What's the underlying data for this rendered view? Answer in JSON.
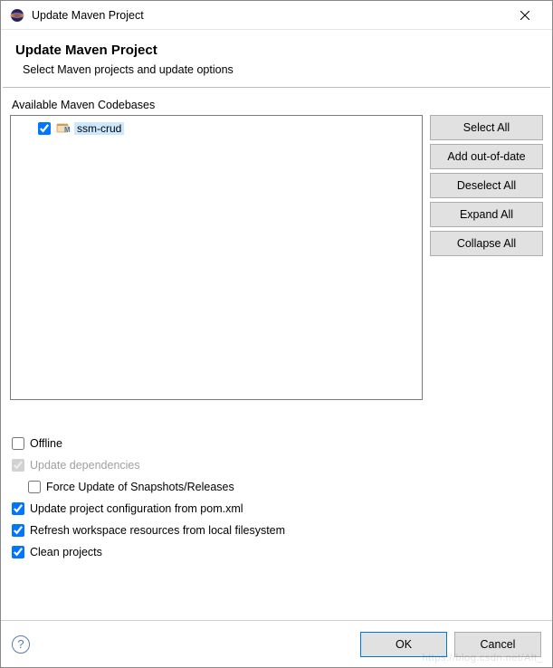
{
  "titlebar": {
    "title": "Update Maven Project"
  },
  "header": {
    "title": "Update Maven Project",
    "subtitle": "Select Maven projects and update options"
  },
  "codebases": {
    "label": "Available Maven Codebases",
    "items": [
      {
        "label": "ssm-crud",
        "checked": true,
        "selected": true
      }
    ]
  },
  "side_buttons": {
    "select_all": "Select All",
    "add_ood": "Add out-of-date",
    "deselect_all": "Deselect All",
    "expand_all": "Expand All",
    "collapse_all": "Collapse All"
  },
  "options": {
    "offline": {
      "label": "Offline",
      "checked": false
    },
    "update_deps": {
      "label": "Update dependencies",
      "checked": true,
      "disabled": true
    },
    "force_update": {
      "label": "Force Update of Snapshots/Releases",
      "checked": false
    },
    "update_proj_conf": {
      "label": "Update project configuration from pom.xml",
      "checked": true
    },
    "refresh_ws": {
      "label": "Refresh workspace resources from local filesystem",
      "checked": true
    },
    "clean_projects": {
      "label": "Clean projects",
      "checked": true
    }
  },
  "footer": {
    "ok": "OK",
    "cancel": "Cancel"
  },
  "watermark": "https://blog.csdn.net/Alt_"
}
